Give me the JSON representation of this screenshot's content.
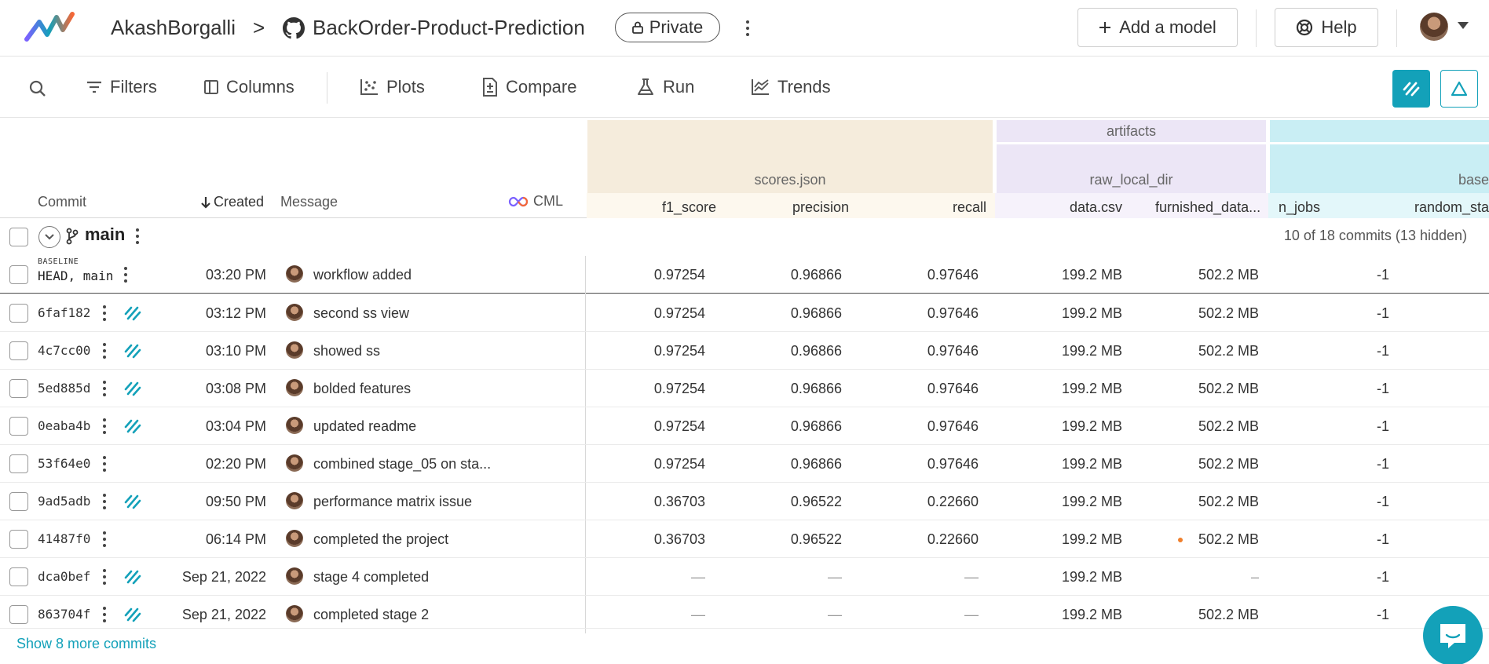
{
  "header": {
    "owner": "AkashBorgalli",
    "separator": ">",
    "repo": "BackOrder-Product-Prediction",
    "visibility": "Private",
    "add_model_label": "Add a model",
    "help_label": "Help"
  },
  "toolbar": {
    "filters": "Filters",
    "columns": "Columns",
    "plots": "Plots",
    "compare": "Compare",
    "run": "Run",
    "trends": "Trends"
  },
  "table_header": {
    "commit": "Commit",
    "created": "Created",
    "message": "Message",
    "cml": "CML",
    "group_scores": "scores.json",
    "group_artifacts": "artifacts",
    "group_raw_local_dir": "raw_local_dir",
    "group_base": "base",
    "col_f1": "f1_score",
    "col_precision": "precision",
    "col_recall": "recall",
    "col_data_csv": "data.csv",
    "col_furnished": "furnished_data...",
    "col_n_jobs": "n_jobs",
    "col_random_state": "random_sta"
  },
  "branch": {
    "name": "main",
    "count_text": "10 of 18 commits (13 hidden)"
  },
  "baseline_tag": "BASELINE",
  "rows": [
    {
      "hash": "HEAD, main",
      "time": "03:20 PM",
      "message": "workflow added",
      "f1": "0.97254",
      "precision": "0.96866",
      "recall": "0.97646",
      "data_csv": "199.2 MB",
      "furnished": "502.2 MB",
      "n_jobs": "-1"
    },
    {
      "hash": "6faf182",
      "time": "03:12 PM",
      "message": "second ss view",
      "f1": "0.97254",
      "precision": "0.96866",
      "recall": "0.97646",
      "data_csv": "199.2 MB",
      "furnished": "502.2 MB",
      "n_jobs": "-1"
    },
    {
      "hash": "4c7cc00",
      "time": "03:10 PM",
      "message": "showed ss",
      "f1": "0.97254",
      "precision": "0.96866",
      "recall": "0.97646",
      "data_csv": "199.2 MB",
      "furnished": "502.2 MB",
      "n_jobs": "-1"
    },
    {
      "hash": "5ed885d",
      "time": "03:08 PM",
      "message": "bolded features",
      "f1": "0.97254",
      "precision": "0.96866",
      "recall": "0.97646",
      "data_csv": "199.2 MB",
      "furnished": "502.2 MB",
      "n_jobs": "-1"
    },
    {
      "hash": "0eaba4b",
      "time": "03:04 PM",
      "message": "updated readme",
      "f1": "0.97254",
      "precision": "0.96866",
      "recall": "0.97646",
      "data_csv": "199.2 MB",
      "furnished": "502.2 MB",
      "n_jobs": "-1"
    },
    {
      "hash": "53f64e0",
      "time": "02:20 PM",
      "message": "combined stage_05 on sta...",
      "f1": "0.97254",
      "precision": "0.96866",
      "recall": "0.97646",
      "data_csv": "199.2 MB",
      "furnished": "502.2 MB",
      "n_jobs": "-1"
    },
    {
      "hash": "9ad5adb",
      "time": "09:50 PM",
      "message": "performance matrix issue",
      "f1": "0.36703",
      "precision": "0.96522",
      "recall": "0.22660",
      "data_csv": "199.2 MB",
      "furnished": "502.2 MB",
      "n_jobs": "-1"
    },
    {
      "hash": "41487f0",
      "time": "06:14 PM",
      "message": "completed the project",
      "f1": "0.36703",
      "precision": "0.96522",
      "recall": "0.22660",
      "data_csv": "199.2 MB",
      "furnished": "502.2 MB",
      "n_jobs": "-1"
    },
    {
      "hash": "dca0bef",
      "time": "Sep 21, 2022",
      "message": "stage 4 completed",
      "f1": "—",
      "precision": "—",
      "recall": "—",
      "data_csv": "199.2 MB",
      "furnished": "–",
      "n_jobs": "-1"
    },
    {
      "hash": "863704f",
      "time": "Sep 21, 2022",
      "message": "completed stage 2",
      "f1": "—",
      "precision": "—",
      "recall": "—",
      "data_csv": "199.2 MB",
      "furnished": "502.2 MB",
      "n_jobs": "-1"
    }
  ],
  "show_more": "Show 8 more commits",
  "colors": {
    "accent": "#13a1b9",
    "scores_bg": "#f5ecdc",
    "scores_col_bg": "#fdf8ee",
    "artifacts_bg": "#ece6f6",
    "artifacts_col_bg": "#f6f2fb",
    "base_bg": "#c9eef4",
    "base_col_bg": "#e3f7fa"
  }
}
